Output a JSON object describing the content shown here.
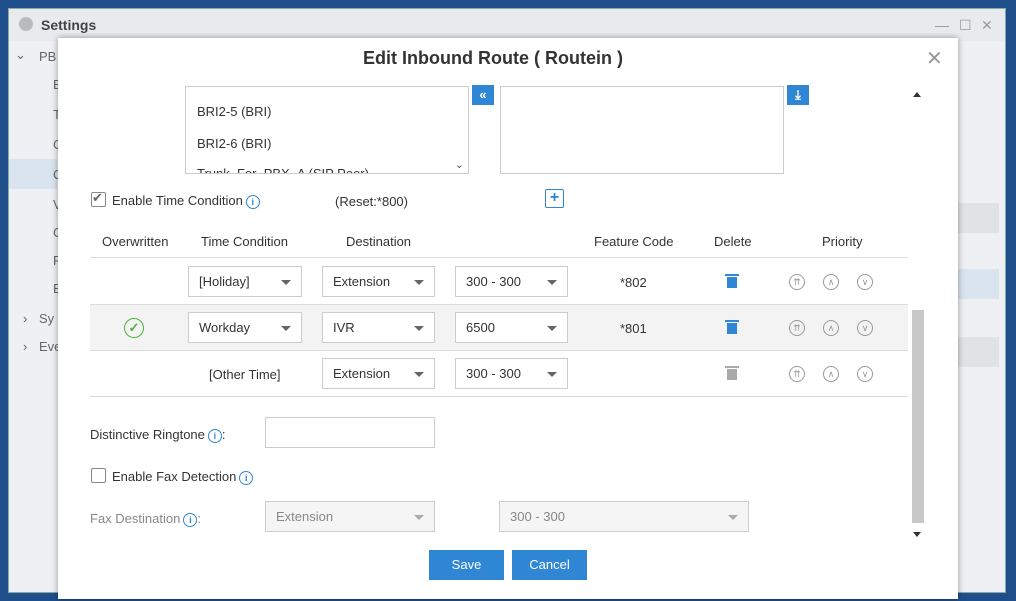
{
  "window": {
    "title": "Settings",
    "sidebar": [
      "PB",
      "E",
      "T",
      "C",
      "C",
      "V",
      "C",
      "F",
      "E"
    ],
    "sidebar_groups": [
      "Sy",
      "Eve"
    ]
  },
  "modal": {
    "title": "Edit Inbound Route ( Routein )",
    "trunk_list": [
      "BRI2-5 (BRI)",
      "BRI2-6 (BRI)",
      "Trunk_For_PBX_A (SIP Peer)"
    ],
    "enable_time_condition_label": "Enable Time Condition",
    "reset_text": "(Reset:*800)",
    "table": {
      "headers": [
        "Overwritten",
        "Time Condition",
        "Destination",
        "Feature Code",
        "Delete",
        "Priority"
      ],
      "rows": [
        {
          "time_condition": "[Holiday]",
          "destination": "Extension",
          "target": "300 - 300",
          "feature_code": "*802"
        },
        {
          "time_condition": "Workday",
          "destination": "IVR",
          "target": "6500",
          "feature_code": "*801"
        },
        {
          "time_condition": "[Other Time]",
          "destination": "Extension",
          "target": "300 - 300",
          "feature_code": ""
        }
      ]
    },
    "distinctive_ringtone_label": "Distinctive Ringtone",
    "distinctive_ringtone_value": "",
    "enable_fax_label": "Enable Fax Detection",
    "fax_destination_label": "Fax Destination",
    "fax_destination_type": "Extension",
    "fax_destination_target": "300 - 300",
    "save_label": "Save",
    "cancel_label": "Cancel",
    "colon": ":"
  },
  "colors": {
    "accent": "#2e86d4",
    "ok": "#52b043"
  }
}
